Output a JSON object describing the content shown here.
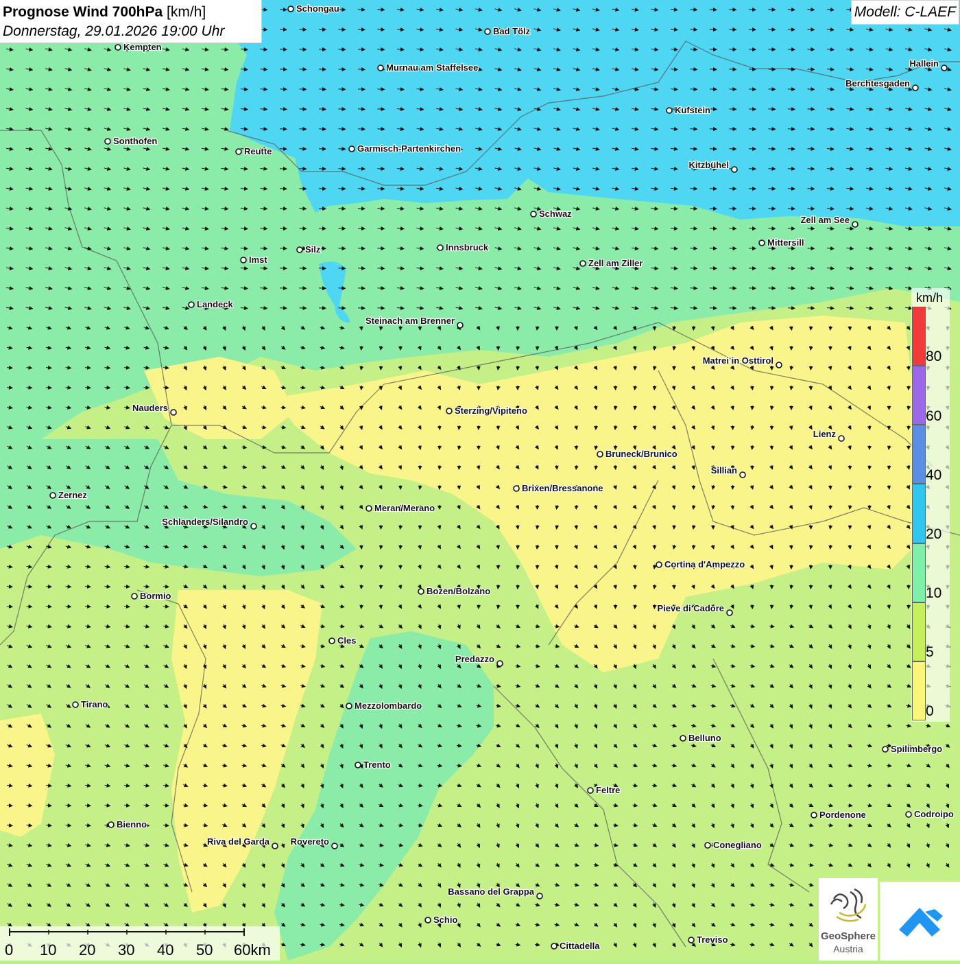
{
  "header": {
    "title_bold": "Prognose Wind 700hPa",
    "title_unit": "[km/h]",
    "date": "Donnerstag, 29.01.2026 19:00 Uhr",
    "model": "Modell: C-LAEF"
  },
  "legend": {
    "unit": "km/h",
    "labels": [
      "80",
      "60",
      "40",
      "20",
      "10",
      "5",
      "0"
    ],
    "colors": [
      "#f23a3a",
      "#9b68ea",
      "#5b8fe5",
      "#2fc7f0",
      "#7ff0a8",
      "#c6f05a",
      "#fbf57a"
    ]
  },
  "scale_bar": {
    "labels": [
      "0",
      "10",
      "20",
      "30",
      "40",
      "50",
      "60km"
    ]
  },
  "logos": {
    "geosphere_line1": "GeoSphere",
    "geosphere_line2": "Austria"
  },
  "colors": {
    "calm": "#faf58a",
    "light": "#c5f088",
    "moderate": "#8aeca8",
    "strong": "#4fd6f2"
  },
  "cities": [
    {
      "name": "Schongau"
    },
    {
      "name": "Bad Tölz"
    },
    {
      "name": "Kempten"
    },
    {
      "name": "Murnau am Staffelsee"
    },
    {
      "name": "Hallein"
    },
    {
      "name": "Berchtesgaden"
    },
    {
      "name": "Kufstein"
    },
    {
      "name": "Sonthofen"
    },
    {
      "name": "Reutte"
    },
    {
      "name": "Garmisch-Partenkirchen"
    },
    {
      "name": "Kitzbühel"
    },
    {
      "name": "Schwaz"
    },
    {
      "name": "Zell am See"
    },
    {
      "name": "Mittersill"
    },
    {
      "name": "Innsbruck"
    },
    {
      "name": "Silz"
    },
    {
      "name": "Imst"
    },
    {
      "name": "Zell am Ziller"
    },
    {
      "name": "Landeck"
    },
    {
      "name": "Steinach am Brenner"
    },
    {
      "name": "Matrei in Osttirol"
    },
    {
      "name": "Nauders"
    },
    {
      "name": "Sterzing/Vipiteno"
    },
    {
      "name": "Lienz"
    },
    {
      "name": "Bruneck/Brunico"
    },
    {
      "name": "Sillian"
    },
    {
      "name": "Brixen/Bressanone"
    },
    {
      "name": "Zernez"
    },
    {
      "name": "Meran/Merano"
    },
    {
      "name": "Schlanders/Silandro"
    },
    {
      "name": "Cortina d'Ampezzo"
    },
    {
      "name": "Bozen/Bolzano"
    },
    {
      "name": "Bormio"
    },
    {
      "name": "Pieve di Cadore"
    },
    {
      "name": "Cles"
    },
    {
      "name": "Predazzo"
    },
    {
      "name": "Tirano"
    },
    {
      "name": "Mezzolombardo"
    },
    {
      "name": "Belluno"
    },
    {
      "name": "Spilimbergo"
    },
    {
      "name": "Trento"
    },
    {
      "name": "Feltre"
    },
    {
      "name": "Pordenone"
    },
    {
      "name": "Codroipo"
    },
    {
      "name": "Bienno"
    },
    {
      "name": "Riva del Garda"
    },
    {
      "name": "Rovereto"
    },
    {
      "name": "Conegliano"
    },
    {
      "name": "Bassano del Grappa"
    },
    {
      "name": "Schio"
    },
    {
      "name": "Treviso"
    },
    {
      "name": "Cittadella"
    }
  ]
}
